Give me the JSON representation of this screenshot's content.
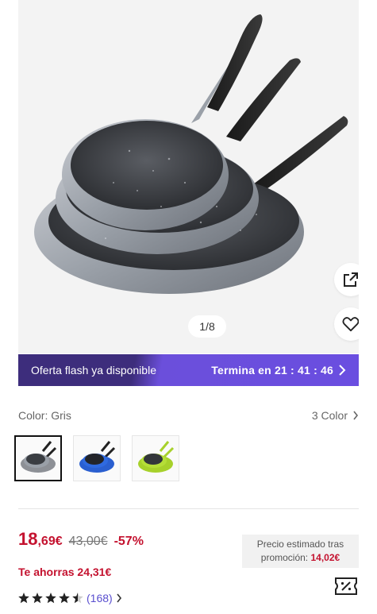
{
  "gallery": {
    "counter": "1/8",
    "share_icon": "external-link-icon",
    "favorite_icon": "heart-icon"
  },
  "flash_banner": {
    "label": "Oferta flash ya disponible",
    "ends_label": "Termina en 21 : 41 : 46"
  },
  "color_selector": {
    "current": "Color: Gris",
    "count": "3 Color",
    "options": [
      {
        "name": "Gris",
        "accent": "#8d9096",
        "selected": true
      },
      {
        "name": "Azul",
        "accent": "#2a5fd0",
        "selected": false
      },
      {
        "name": "Verde",
        "accent": "#a7d12b",
        "selected": false
      }
    ]
  },
  "pricing": {
    "price_int": "18",
    "price_dec": ",69€",
    "price_old": "43,00€",
    "discount": "-57%",
    "savings": "Te ahorras 24,31€",
    "promo_line1": "Precio estimado tras",
    "promo_line2_label": "promoción:",
    "promo_value": "14,02€"
  },
  "reviews": {
    "rating": 4.5,
    "count": "(168)"
  },
  "colors": {
    "accent_red": "#c4122f",
    "accent_purple": "#6a4ee0",
    "link_purple": "#5a4fcf"
  }
}
